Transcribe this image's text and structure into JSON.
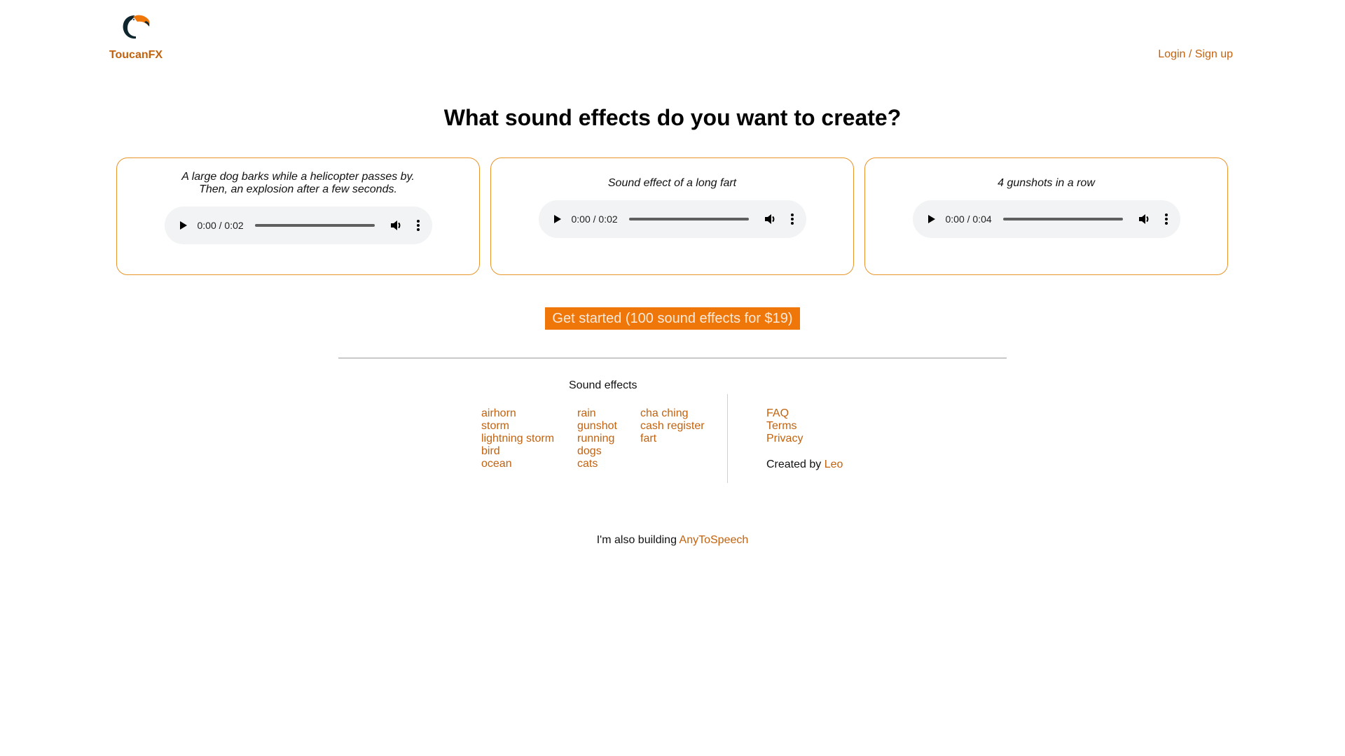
{
  "header": {
    "brand_name": "ToucanFX",
    "login_label": "Login / Sign up"
  },
  "main": {
    "title": "What sound effects do you want to create?",
    "examples": [
      {
        "line1": "A large dog barks while a helicopter passes by.",
        "line2": "Then, an explosion after a few seconds.",
        "time": "0:00 / 0:02"
      },
      {
        "line1": "Sound effect of a long fart",
        "line2": "",
        "time": "0:00 / 0:02"
      },
      {
        "line1": "4 gunshots in a row",
        "line2": "",
        "time": "0:00 / 0:04"
      }
    ],
    "cta_label": "Get started (100 sound effects for $19)"
  },
  "footer": {
    "sound_effects_title": "Sound effects",
    "columns": [
      [
        "airhorn",
        "storm",
        "lightning storm",
        "bird",
        "ocean"
      ],
      [
        "rain",
        "gunshot",
        "running",
        "dogs",
        "cats"
      ],
      [
        "cha ching",
        "cash register",
        "fart"
      ]
    ],
    "links": [
      "FAQ",
      "Terms",
      "Privacy"
    ],
    "created_by_prefix": "Created by ",
    "created_by_name": "Leo",
    "also_prefix": "I'm also building ",
    "also_link": "AnyToSpeech"
  },
  "colors": {
    "accent": "#ef7609",
    "link": "#c2620e",
    "card_border": "#e8952a"
  },
  "icons": {
    "logo": "toucan-logo-icon",
    "play": "play-icon",
    "volume": "volume-icon",
    "more": "more-vertical-icon"
  }
}
